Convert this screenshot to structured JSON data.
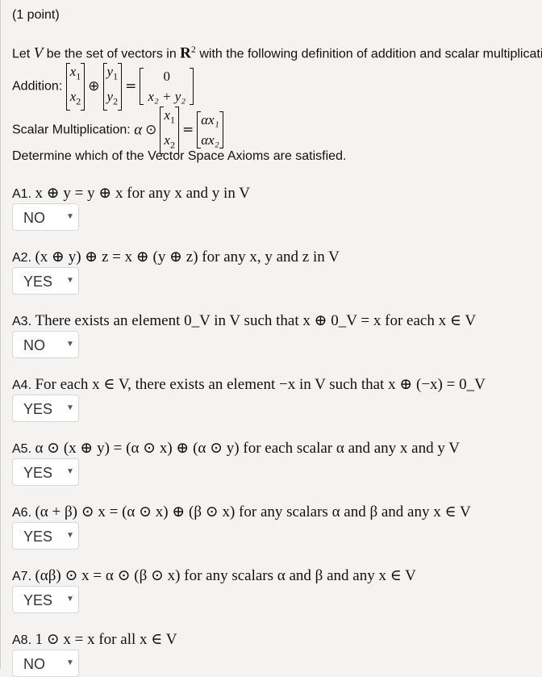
{
  "points": "(1 point)",
  "intro": {
    "text_pre": "Let ",
    "V": "V",
    "text_mid": " be the set of vectors in ",
    "R": "R",
    "sup": "2",
    "text_post": " with the following definition of addition and scalar multiplication:"
  },
  "addition": {
    "label": "Addition:",
    "x1": "x",
    "x1_sub": "1",
    "x2": "x",
    "x2_sub": "2",
    "y1": "y",
    "y1_sub": "1",
    "y2": "y",
    "y2_sub": "2",
    "oplus": "⊕",
    "eq": "=",
    "r1": "0",
    "r2": "x₂ + y₂"
  },
  "scalar": {
    "label": "Scalar Multiplication:",
    "alpha": "α",
    "odot": "⊙",
    "eq": "=",
    "x1": "x",
    "x1_sub": "1",
    "x2": "x",
    "x2_sub": "2",
    "r1": "αx₁",
    "r2": "αx₂"
  },
  "instruction": "Determine which of the Vector Space Axioms are satisfied.",
  "axioms": [
    {
      "label": "A1.",
      "statement": "x ⊕ y = y ⊕ x for any x and y in V",
      "answer": "NO"
    },
    {
      "label": "A2.",
      "statement": "(x ⊕ y) ⊕ z = x ⊕ (y ⊕ z) for any x, y and z in V",
      "answer": "YES"
    },
    {
      "label": "A3.",
      "statement": "There exists an element 0_V in V such that x ⊕ 0_V = x for each x ∈ V",
      "answer": "NO"
    },
    {
      "label": "A4.",
      "statement": "For each x ∈ V, there exists an element −x in V such that x ⊕ (−x) = 0_V",
      "answer": "YES"
    },
    {
      "label": "A5.",
      "statement": "α ⊙ (x ⊕ y) = (α ⊙ x) ⊕ (α ⊙ y) for each scalar α and any x and y V",
      "answer": "YES"
    },
    {
      "label": "A6.",
      "statement": "(α + β) ⊙ x = (α ⊙ x) ⊕ (β ⊙ x) for any scalars α and β and any x ∈ V",
      "answer": "YES"
    },
    {
      "label": "A7.",
      "statement": "(αβ) ⊙ x = α ⊙ (β ⊙ x) for any scalars α and β and any x ∈ V",
      "answer": "YES"
    },
    {
      "label": "A8.",
      "statement": "1 ⊙ x = x for all x ∈ V",
      "answer": "NO"
    }
  ],
  "caret_icon": "▼"
}
